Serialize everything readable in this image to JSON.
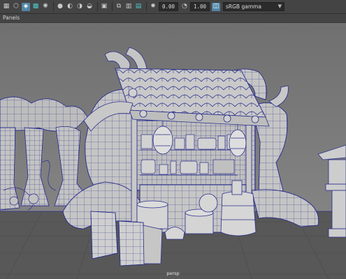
{
  "toolbar": {
    "exposure_value": "0.00",
    "gamma_value": "1.00",
    "color_space": "sRGB gamma",
    "icons": [
      "grid-icon",
      "cube-icon",
      "wireframe-shaded-icon",
      "texture-icon",
      "light-icon",
      "camera-icon",
      "sphere-icon",
      "shadow-icon",
      "ao-icon",
      "aa-icon",
      "isolate-icon",
      "xray-icon",
      "backface-icon",
      "colorspace-icon"
    ]
  },
  "menubar": {
    "panels_label": "Panels"
  },
  "viewport": {
    "camera_label": "persp"
  },
  "colors": {
    "ui_bg": "#444444",
    "viewport_bg": "#777777",
    "mesh_fill": "#c9c9c9",
    "wire": "#2b2f8c",
    "highlight": "#5285a6"
  }
}
